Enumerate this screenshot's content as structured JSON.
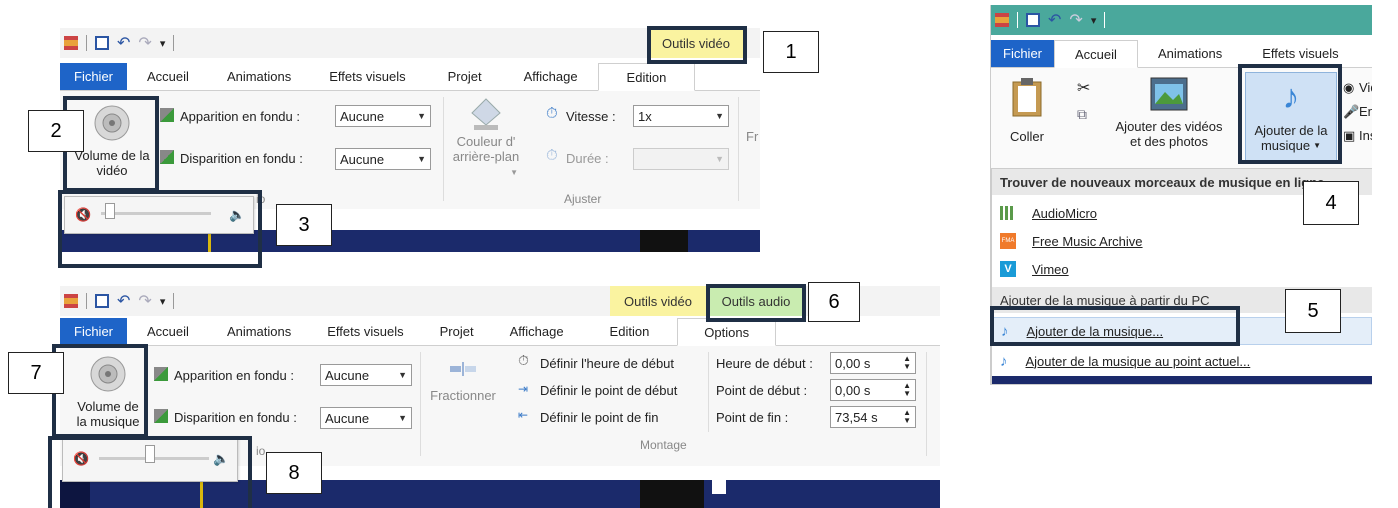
{
  "colors": {
    "file_tab": "#1e64c8",
    "ctx_video": "#faf3a0",
    "ctx_audio": "#c9ecb0",
    "callout": "#1f2f45"
  },
  "callouts": {
    "n1": "1",
    "n2": "2",
    "n3": "3",
    "n4": "4",
    "n5": "5",
    "n6": "6",
    "n7": "7",
    "n8": "8"
  },
  "video_panel": {
    "context_tab": "Outils vidéo",
    "tabs": [
      "Fichier",
      "Accueil",
      "Animations",
      "Effets visuels",
      "Projet",
      "Affichage",
      "Edition"
    ],
    "volume_button": "Volume de la vidéo",
    "fade_in_label": "Apparition en fondu :",
    "fade_in_value": "Aucune",
    "fade_out_label": "Disparition en fondu :",
    "fade_out_value": "Aucune",
    "bg_color_label": "Couleur d' arrière-plan",
    "speed_label": "Vitesse :",
    "speed_value": "1x",
    "duration_label": "Durée :",
    "group_adjust": "Ajuster",
    "group_audio_partial": "io",
    "cut_label": "Fr"
  },
  "audio_panel": {
    "context_video": "Outils vidéo",
    "context_audio": "Outils audio",
    "tabs": [
      "Fichier",
      "Accueil",
      "Animations",
      "Effets visuels",
      "Projet",
      "Affichage",
      "Edition",
      "Options"
    ],
    "volume_button": "Volume de la musique",
    "fade_in_label": "Apparition en fondu :",
    "fade_in_value": "Aucune",
    "fade_out_label": "Disparition en fondu :",
    "fade_out_value": "Aucune",
    "split_label": "Fractionner",
    "set_start_time": "Définir l'heure de début",
    "set_start_point": "Définir le point de début",
    "set_end_point": "Définir le point de fin",
    "start_time_label": "Heure de début :",
    "start_time_value": "0,00 s",
    "start_point_label": "Point de début :",
    "start_point_value": "0,00 s",
    "end_point_label": "Point de fin :",
    "end_point_value": "73,54 s",
    "group_montage": "Montage",
    "group_audio_partial": "io"
  },
  "home_panel": {
    "tabs": [
      "Fichier",
      "Accueil",
      "Animations",
      "Effets visuels"
    ],
    "paste_label": "Coller",
    "add_media_label_1": "Ajouter des vidéos",
    "add_media_label_2": "et des photos",
    "add_music_label_1": "Ajouter de la",
    "add_music_label_2": "musique",
    "side_items": [
      "Vidé",
      "Enre",
      "Insta"
    ],
    "online_header": "Trouver de nouveaux morceaux de musique en ligne",
    "online_items": [
      "AudioMicro",
      "Free Music Archive",
      "Vimeo"
    ],
    "pc_header": "Ajouter de la musique à partir du PC",
    "pc_items": [
      "Ajouter de la musique...",
      "Ajouter de la musique au point actuel..."
    ],
    "fma_badge": "FMA",
    "vimeo_badge": "V"
  }
}
